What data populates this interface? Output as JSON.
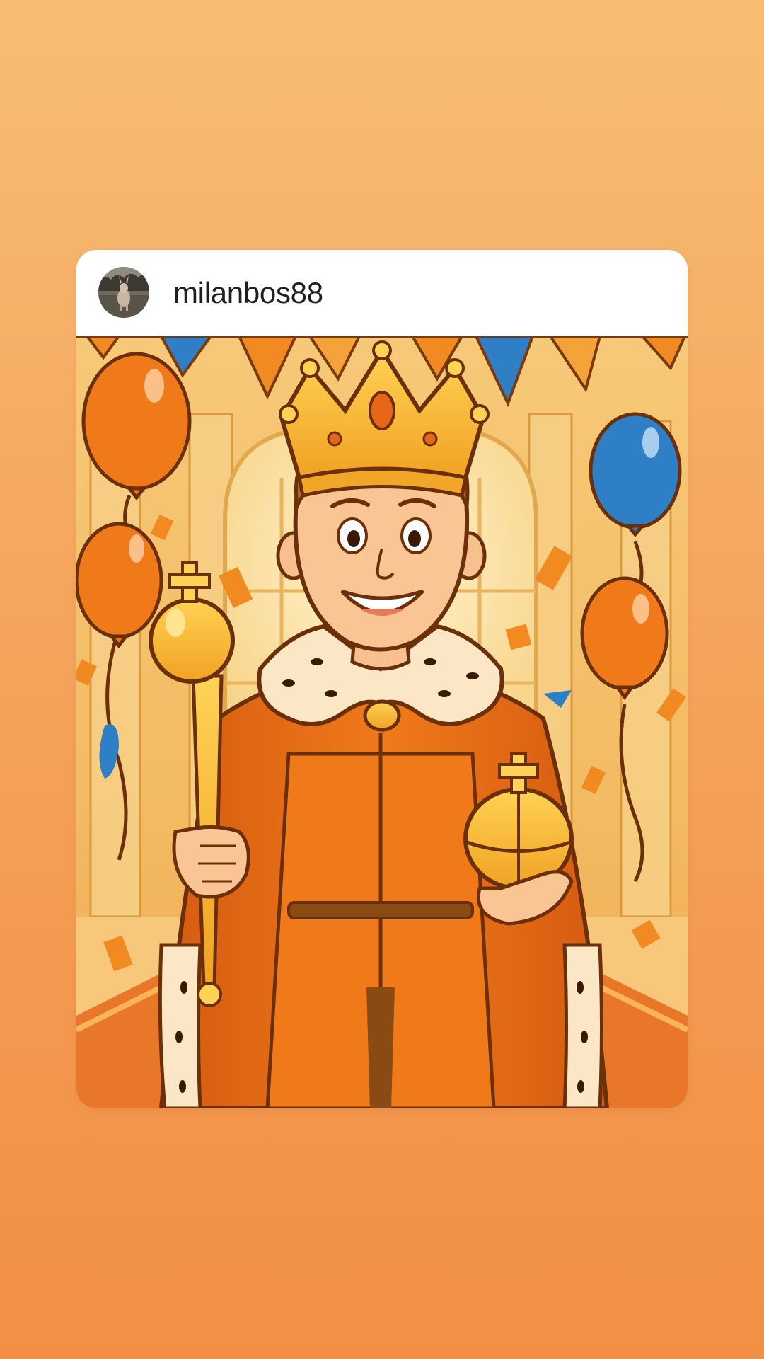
{
  "story": {
    "username": "milanbos88",
    "avatar_icon": "user-avatar-photo",
    "image_subject": "cartoon-king-illustration"
  },
  "colors": {
    "background_top": "#f8bd73",
    "background_bottom": "#f28f45",
    "card_background": "#ffffff",
    "username_color": "#1f1f1f"
  }
}
